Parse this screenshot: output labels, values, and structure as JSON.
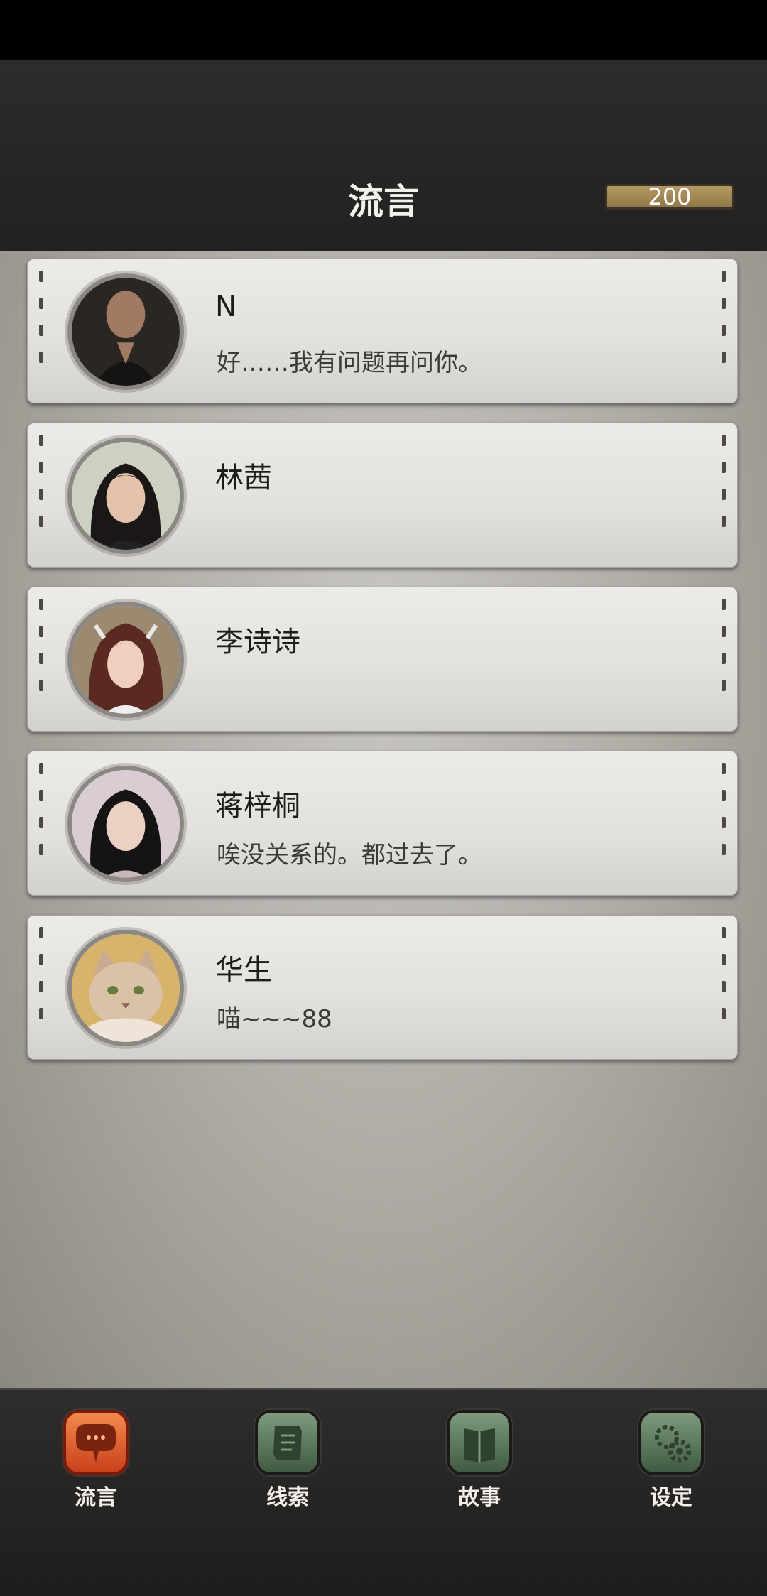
{
  "header": {
    "title": "流言",
    "coins": "200"
  },
  "contacts": [
    {
      "name": "N",
      "message": "好……我有问题再问你。"
    },
    {
      "name": "林茜",
      "message": ""
    },
    {
      "name": "李诗诗",
      "message": ""
    },
    {
      "name": "蒋梓桐",
      "message": "唉没关系的。都过去了。"
    },
    {
      "name": "华生",
      "message": "喵~~~88"
    }
  ],
  "tabs": [
    {
      "label": "流言",
      "icon": "chat-bubble-icon",
      "active": true
    },
    {
      "label": "线索",
      "icon": "scroll-icon",
      "active": false
    },
    {
      "label": "故事",
      "icon": "book-icon",
      "active": false
    },
    {
      "label": "设定",
      "icon": "gear-icon",
      "active": false
    }
  ],
  "colors": {
    "active_tab": "#e05a2a",
    "inactive_tab": "#5d7a5c",
    "coin_badge": "#a88b57"
  }
}
